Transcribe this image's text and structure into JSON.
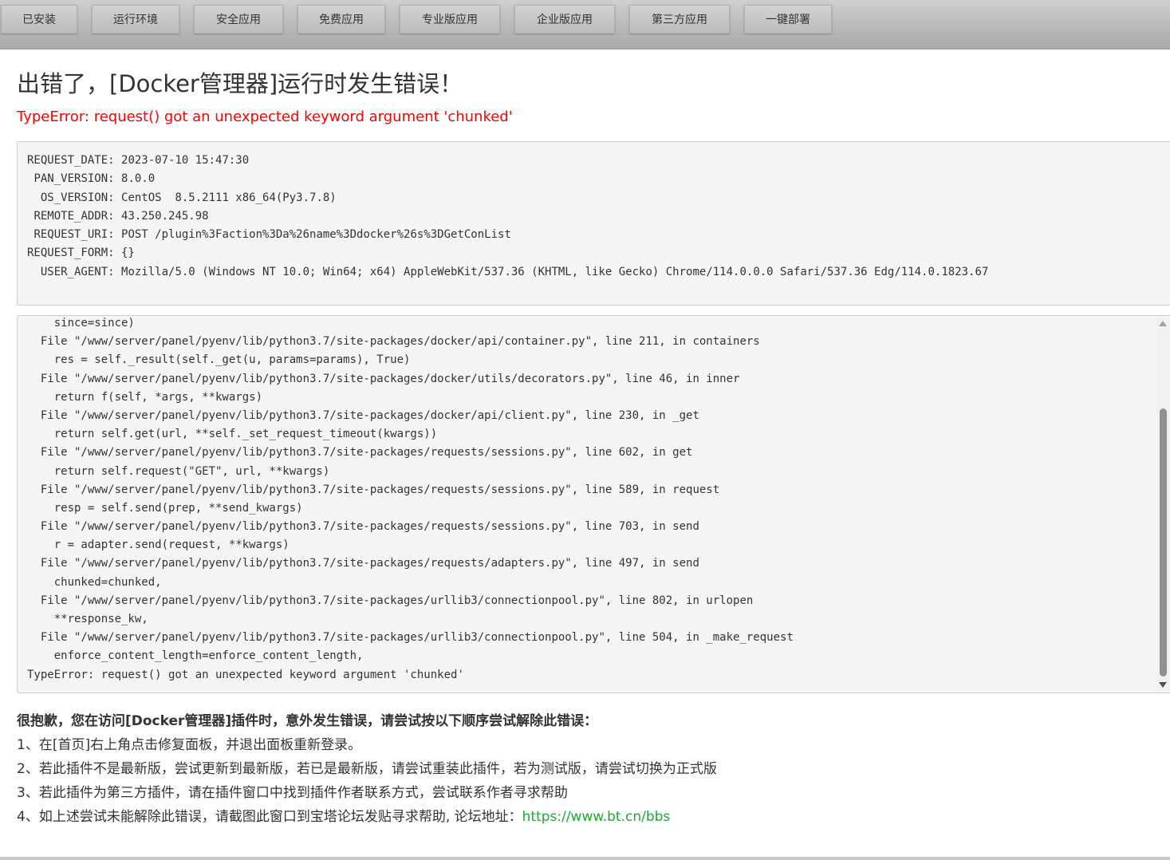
{
  "nav": {
    "tabs": [
      {
        "label": "已安装"
      },
      {
        "label": "运行环境"
      },
      {
        "label": "安全应用"
      },
      {
        "label": "免费应用"
      },
      {
        "label": "专业版应用"
      },
      {
        "label": "企业版应用"
      },
      {
        "label": "第三方应用"
      },
      {
        "label": "一键部署"
      }
    ]
  },
  "error": {
    "title": "出错了，[Docker管理器]运行时发生错误！",
    "message": "TypeError: request() got an unexpected keyword argument 'chunked'"
  },
  "request_info": [
    {
      "key": "REQUEST_DATE",
      "value": "2023-07-10 15:47:30"
    },
    {
      "key": "PAN_VERSION",
      "value": "8.0.0"
    },
    {
      "key": "OS_VERSION",
      "value": "CentOS  8.5.2111 x86_64(Py3.7.8)"
    },
    {
      "key": "REMOTE_ADDR",
      "value": "43.250.245.98"
    },
    {
      "key": "REQUEST_URI",
      "value": "POST /plugin%3Faction%3Da%26name%3Ddocker%26s%3DGetConList"
    },
    {
      "key": "REQUEST_FORM",
      "value": "{}"
    },
    {
      "key": "USER_AGENT",
      "value": "Mozilla/5.0 (Windows NT 10.0; Win64; x64) AppleWebKit/537.36 (KHTML, like Gecko) Chrome/114.0.0.0 Safari/537.36 Edg/114.0.1823.67"
    }
  ],
  "traceback": [
    "    since=since)",
    "  File \"/www/server/panel/pyenv/lib/python3.7/site-packages/docker/api/container.py\", line 211, in containers",
    "    res = self._result(self._get(u, params=params), True)",
    "  File \"/www/server/panel/pyenv/lib/python3.7/site-packages/docker/utils/decorators.py\", line 46, in inner",
    "    return f(self, *args, **kwargs)",
    "  File \"/www/server/panel/pyenv/lib/python3.7/site-packages/docker/api/client.py\", line 230, in _get",
    "    return self.get(url, **self._set_request_timeout(kwargs))",
    "  File \"/www/server/panel/pyenv/lib/python3.7/site-packages/requests/sessions.py\", line 602, in get",
    "    return self.request(\"GET\", url, **kwargs)",
    "  File \"/www/server/panel/pyenv/lib/python3.7/site-packages/requests/sessions.py\", line 589, in request",
    "    resp = self.send(prep, **send_kwargs)",
    "  File \"/www/server/panel/pyenv/lib/python3.7/site-packages/requests/sessions.py\", line 703, in send",
    "    r = adapter.send(request, **kwargs)",
    "  File \"/www/server/panel/pyenv/lib/python3.7/site-packages/requests/adapters.py\", line 497, in send",
    "    chunked=chunked,",
    "  File \"/www/server/panel/pyenv/lib/python3.7/site-packages/urllib3/connectionpool.py\", line 802, in urlopen",
    "    **response_kw,",
    "  File \"/www/server/panel/pyenv/lib/python3.7/site-packages/urllib3/connectionpool.py\", line 504, in _make_request",
    "    enforce_content_length=enforce_content_length,",
    "TypeError: request() got an unexpected keyword argument 'chunked'"
  ],
  "help": {
    "heading": "很抱歉，您在访问[Docker管理器]插件时，意外发生错误，请尝试按以下顺序尝试解除此错误：",
    "items": [
      "1、在[首页]右上角点击修复面板，并退出面板重新登录。",
      "2、若此插件不是最新版，尝试更新到最新版，若已是最新版，请尝试重装此插件，若为测试版，请尝试切换为正式版",
      "3、若此插件为第三方插件，请在插件窗口中找到插件作者联系方式，尝试联系作者寻求帮助",
      "4、如上述尝试未能解除此错误，请截图此窗口到宝塔论坛发贴寻求帮助, 论坛地址："
    ],
    "forum_url": "https://www.bt.cn/bbs"
  },
  "colors": {
    "error_red": "#ff0000",
    "link_green": "#20a53a"
  },
  "icons": {
    "scroll_up": "triangle-up-icon",
    "scroll_down": "triangle-down-icon"
  }
}
